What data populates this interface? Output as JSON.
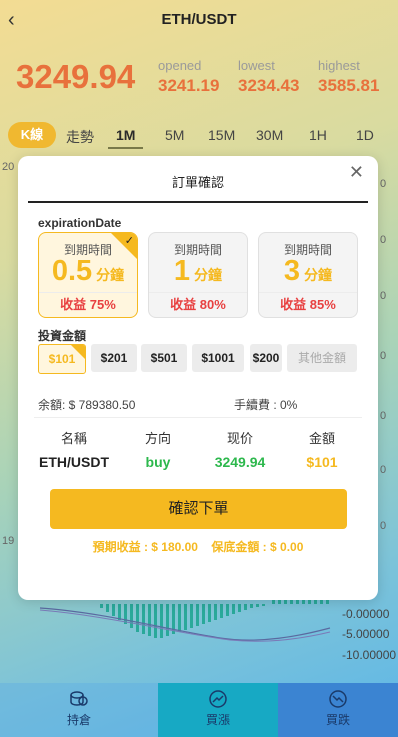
{
  "header": {
    "back_icon": "chevron-left-icon",
    "title": "ETH/USDT"
  },
  "ticker": {
    "price": "3249.94",
    "opened_label": "opened",
    "opened": "3241.19",
    "lowest_label": "lowest",
    "lowest": "3234.43",
    "highest_label": "highest",
    "highest": "3585.81"
  },
  "chart_tabs": [
    "K線",
    "走勢",
    "1M",
    "5M",
    "15M",
    "30M",
    "1H",
    "1D"
  ],
  "chart_fragments": {
    "left_top": "20",
    "left_mid": "19",
    "right_top": "0",
    "r1": "0",
    "r2": "0",
    "r3": "0",
    "r4": "0",
    "r5": "0",
    "r6": "0"
  },
  "modal": {
    "title": "訂單確認",
    "close_icon": "close-icon",
    "expiration_label": "expirationDate",
    "cards": [
      {
        "heading": "到期時間",
        "value": "0.5",
        "unit": "分鐘",
        "yield": "收益 75%",
        "selected": true
      },
      {
        "heading": "到期時間",
        "value": "1",
        "unit": "分鐘",
        "yield": "收益 80%",
        "selected": false
      },
      {
        "heading": "到期時間",
        "value": "3",
        "unit": "分鐘",
        "yield": "收益 85%",
        "selected": false
      }
    ],
    "amount_label": "投資金額",
    "amounts": [
      "$101",
      "$201",
      "$501",
      "$1001",
      "$200"
    ],
    "other_amount": "其他金額",
    "balance": "余額: $ 789380.50",
    "fee": "手續費 : 0%",
    "table_headers": [
      "名稱",
      "方向",
      "现价",
      "金額"
    ],
    "table_values": {
      "name": "ETH/USDT",
      "direction": "buy",
      "price": "3249.94",
      "amount": "$101"
    },
    "confirm": "確認下單",
    "expected": "預期收益 : $ 180.00",
    "guarantee": "保底金額 : $ 0.00"
  },
  "right_axis": [
    "073",
    "-0.00000",
    "-5.00000",
    "-10.00000"
  ],
  "bottom_nav": [
    {
      "label": "持倉",
      "icon": "coins-icon"
    },
    {
      "label": "買漲",
      "icon": "trend-up-icon"
    },
    {
      "label": "買跌",
      "icon": "trend-down-icon"
    }
  ],
  "colors": {
    "accent": "#f5b920",
    "price": "#e8713c",
    "buy": "#2db84d",
    "yield": "#e84040"
  }
}
